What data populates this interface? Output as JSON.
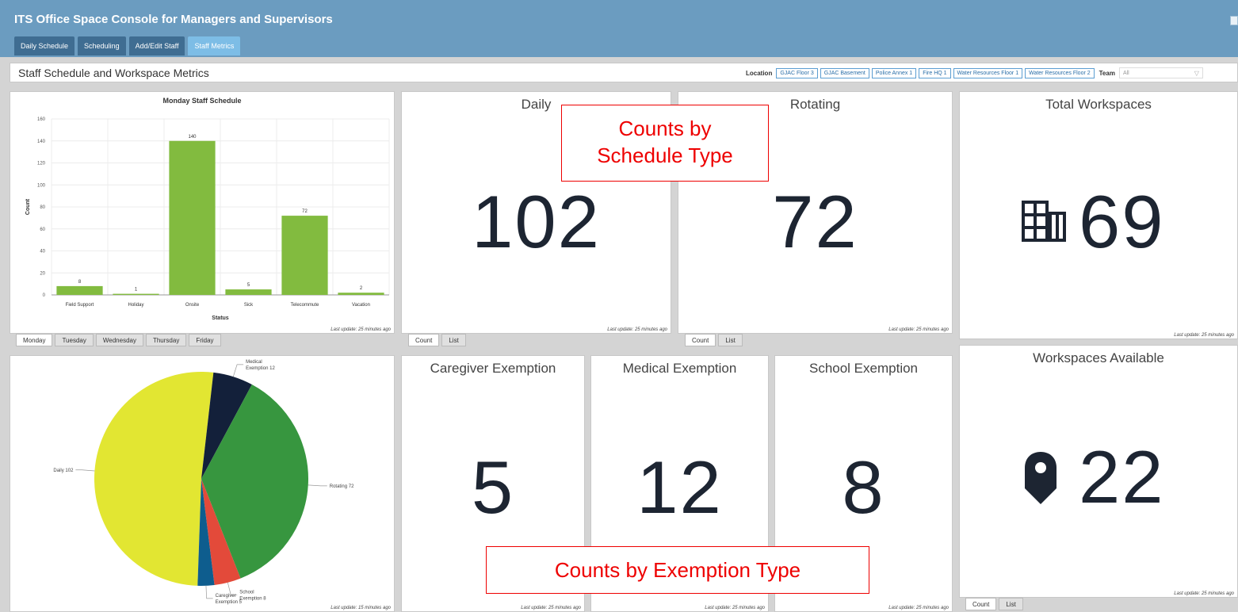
{
  "app": {
    "title": "ITS Office Space Console for Managers and Supervisors"
  },
  "nav": {
    "tabs": [
      {
        "label": "Daily Schedule",
        "active": false
      },
      {
        "label": "Scheduling",
        "active": false
      },
      {
        "label": "Add/Edit Staff",
        "active": false
      },
      {
        "label": "Staff Metrics",
        "active": true
      }
    ]
  },
  "subheader": {
    "title": "Staff Schedule and Workspace Metrics",
    "location_label": "Location",
    "locations": [
      "GJAC Floor 3",
      "GJAC Basement",
      "Police Annex 1",
      "Fire HQ 1",
      "Water Resources Floor 1",
      "Water Resources Floor 2"
    ],
    "team_label": "Team",
    "team_value": "All"
  },
  "bar_panel": {
    "update": "Last update: 25 minutes ago",
    "day_tabs": [
      "Monday",
      "Tuesday",
      "Wednesday",
      "Thursday",
      "Friday"
    ],
    "active_day": "Monday"
  },
  "chart_data": [
    {
      "type": "bar",
      "title": "Monday Staff Schedule",
      "xlabel": "Status",
      "ylabel": "Count",
      "categories": [
        "Field Support",
        "Holiday",
        "Onsite",
        "Sick",
        "Telecommute",
        "Vacation"
      ],
      "values": [
        8,
        1,
        140,
        5,
        72,
        2
      ],
      "ylim": [
        0,
        160
      ],
      "yticks": [
        0,
        20,
        40,
        60,
        80,
        100,
        120,
        140,
        160
      ],
      "color": "#82bb3f",
      "grid": true
    },
    {
      "type": "pie",
      "slices": [
        {
          "label": "Daily 102",
          "value": 102,
          "color": "#e2e632"
        },
        {
          "label": "Medical Exemption 12",
          "value": 12,
          "color": "#13203a"
        },
        {
          "label": "Rotating 72",
          "value": 72,
          "color": "#37963f"
        },
        {
          "label": "School Exemption 8",
          "value": 8,
          "color": "#e34a3a"
        },
        {
          "label": "Caregiver Exemption 5",
          "value": 5,
          "color": "#0e5d8e"
        }
      ]
    }
  ],
  "pie_panel": {
    "update": "Last update: 15 minutes ago"
  },
  "metrics": {
    "daily": {
      "title": "Daily",
      "value": "102",
      "update": "Last update: 25 minutes ago"
    },
    "rotating": {
      "title": "Rotating",
      "value": "72",
      "update": "Last update: 25 minutes ago"
    },
    "total_workspaces": {
      "title": "Total Workspaces",
      "value": "69",
      "icon": "building-icon",
      "update": "Last update: 25 minutes ago"
    },
    "caregiver": {
      "title": "Caregiver Exemption",
      "value": "5",
      "update": "Last update: 25 minutes ago"
    },
    "medical": {
      "title": "Medical Exemption",
      "value": "12",
      "update": "Last update: 25 minutes ago"
    },
    "school": {
      "title": "School Exemption",
      "value": "8",
      "update": "Last update: 25 minutes ago"
    },
    "workspaces_available": {
      "title": "Workspaces Available",
      "value": "22",
      "icon": "map-pin-icon",
      "update": "Last update: 25 minutes ago"
    }
  },
  "view_tabs": {
    "count": "Count",
    "list": "List"
  },
  "annotations": {
    "schedule": "Counts by Schedule Type",
    "exemption": "Counts by Exemption Type"
  }
}
